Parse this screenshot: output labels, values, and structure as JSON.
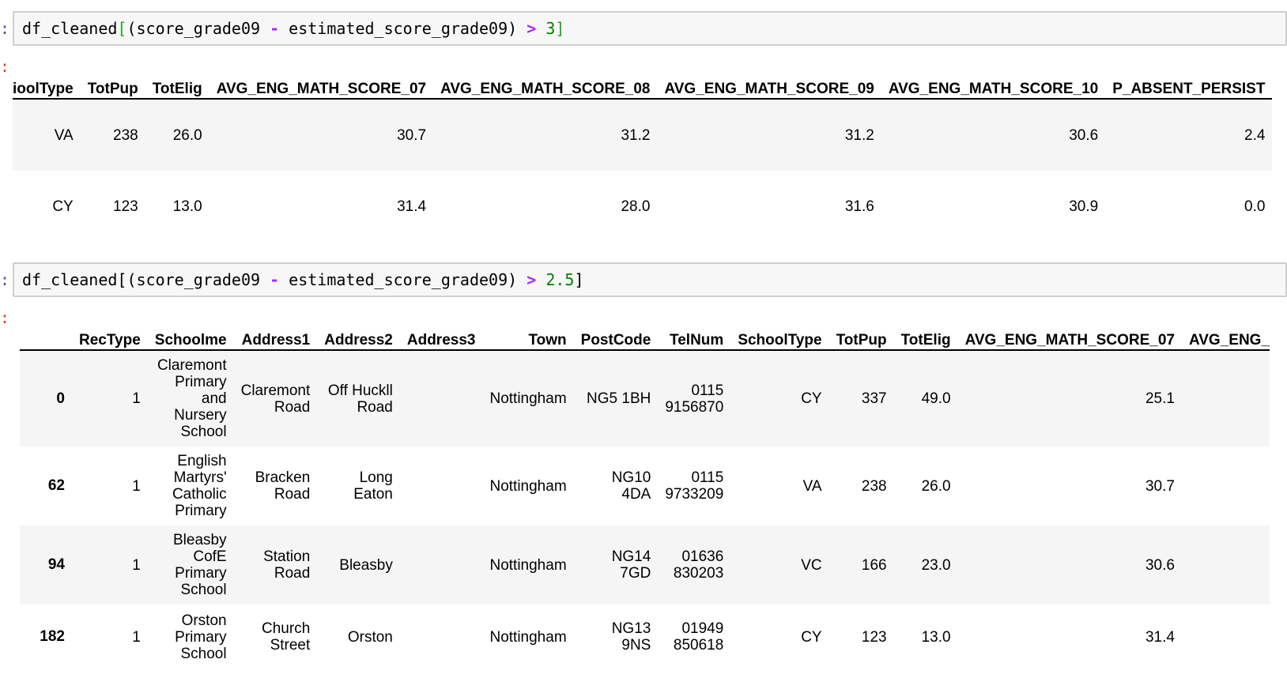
{
  "cells": {
    "cell1": {
      "code_parts": {
        "p1": "df_cleaned",
        "p2": "[",
        "p3": "(score_grade09 ",
        "p4": "-",
        "p5": " estimated_score_grade09) ",
        "p6": ">",
        "p7": " ",
        "p8": "3",
        "p9": "]"
      }
    },
    "cell2": {
      "code_parts": {
        "p1": "df_cleaned",
        "p2": "[",
        "p3": "(score_grade09 ",
        "p4": "-",
        "p5": " estimated_score_grade09) ",
        "p6": ">",
        "p7": " ",
        "p8": "2.5",
        "p9": "]"
      }
    }
  },
  "table1": {
    "columns": [
      "ioolType",
      "TotPup",
      "TotElig",
      "AVG_ENG_MATH_SCORE_07",
      "AVG_ENG_MATH_SCORE_08",
      "AVG_ENG_MATH_SCORE_09",
      "AVG_ENG_MATH_SCORE_10",
      "P_ABSENT_PERSIST"
    ],
    "rows": [
      [
        "VA",
        "238",
        "26.0",
        "30.7",
        "31.2",
        "31.2",
        "30.6",
        "2.4"
      ],
      [
        "CY",
        "123",
        "13.0",
        "31.4",
        "28.0",
        "31.6",
        "30.9",
        "0.0"
      ]
    ]
  },
  "table2": {
    "columns": [
      "",
      "RecType",
      "Schoolme",
      "Address1",
      "Address2",
      "Address3",
      "Town",
      "PostCode",
      "TelNum",
      "SchoolType",
      "TotPup",
      "TotElig",
      "AVG_ENG_MATH_SCORE_07",
      "AVG_ENG_"
    ],
    "rows": [
      [
        "0",
        "1",
        "Claremont Primary and Nursery School",
        "Claremont Road",
        "Off Huckll Road",
        "",
        "Nottingham",
        "NG5 1BH",
        "0115 9156870",
        "CY",
        "337",
        "49.0",
        "25.1",
        ""
      ],
      [
        "62",
        "1",
        "English Martyrs' Catholic Primary",
        "Bracken Road",
        "Long Eaton",
        "",
        "Nottingham",
        "NG10 4DA",
        "0115 9733209",
        "VA",
        "238",
        "26.0",
        "30.7",
        ""
      ],
      [
        "94",
        "1",
        "Bleasby CofE Primary School",
        "Station Road",
        "Bleasby",
        "",
        "Nottingham",
        "NG14 7GD",
        "01636 830203",
        "VC",
        "166",
        "23.0",
        "30.6",
        ""
      ],
      [
        "182",
        "1",
        "Orston Primary School",
        "Church Street",
        "Orston",
        "",
        "Nottingham",
        "NG13 9NS",
        "01949 850618",
        "CY",
        "123",
        "13.0",
        "31.4",
        ""
      ]
    ]
  },
  "colors": {
    "code_bg": "#f7f7f7",
    "operator": "#aa22ff",
    "number": "#008000",
    "in_prompt": "#3f4fb5",
    "out_prompt": "#d84315",
    "row_stripe": "#f5f5f5"
  }
}
